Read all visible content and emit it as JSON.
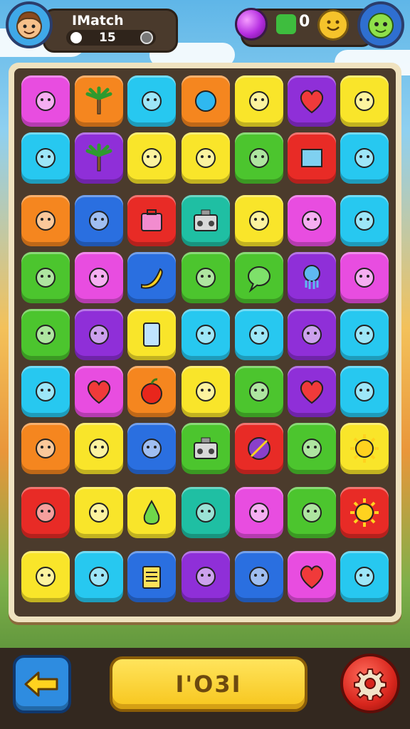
{
  "header": {
    "player_name": "IMatch",
    "score": "15",
    "puzzle_count": "0"
  },
  "footer": {
    "main_button_label": "I'O3I"
  },
  "colors": {
    "pink": "#e84de0",
    "orange": "#f5861f",
    "cyan": "#27c8f0",
    "yellow": "#f9e52a",
    "purple": "#8f2fd8",
    "red": "#e82b26",
    "green": "#4cc52e",
    "blue": "#2a6fe0",
    "teal": "#1fbfa3"
  },
  "board": {
    "rows": [
      [
        {
          "c": "pink",
          "icon": "face-icon"
        },
        {
          "c": "orange",
          "icon": "palm-tree-icon"
        },
        {
          "c": "cyan",
          "icon": "shell-icon"
        },
        {
          "c": "orange",
          "icon": "bubble-icon"
        },
        {
          "c": "yellow",
          "icon": "sprout-icon"
        },
        {
          "c": "purple",
          "icon": "heart-icon"
        },
        {
          "c": "yellow",
          "icon": "monster-icon"
        }
      ],
      [
        {
          "c": "cyan",
          "icon": "jar-icon"
        },
        {
          "c": "purple",
          "icon": "palm-tree-icon"
        },
        {
          "c": "yellow",
          "icon": "leaf-bundle-icon"
        },
        {
          "c": "yellow",
          "icon": "parachute-icon"
        },
        {
          "c": "green",
          "icon": "carrot-icon"
        },
        {
          "c": "red",
          "icon": "window-icon"
        },
        {
          "c": "cyan",
          "icon": "pig-icon"
        }
      ],
      [
        {
          "c": "orange",
          "icon": "splat-icon"
        },
        {
          "c": "blue",
          "icon": "bean-icon"
        },
        {
          "c": "red",
          "icon": "box-icon"
        },
        {
          "c": "teal",
          "icon": "radio-icon"
        },
        {
          "c": "yellow",
          "icon": "pencil-icon"
        },
        {
          "c": "pink",
          "icon": "lamp-icon"
        },
        {
          "c": "cyan",
          "icon": "lion-icon"
        }
      ],
      [
        {
          "c": "green",
          "icon": "robot-icon"
        },
        {
          "c": "pink",
          "icon": "picture-icon"
        },
        {
          "c": "blue",
          "icon": "banana-icon"
        },
        {
          "c": "green",
          "icon": "fox-icon"
        },
        {
          "c": "green",
          "icon": "speech-icon"
        },
        {
          "c": "purple",
          "icon": "octopus-icon"
        },
        {
          "c": "pink",
          "icon": "wave-icon"
        }
      ],
      [
        {
          "c": "green",
          "icon": "kite-icon"
        },
        {
          "c": "purple",
          "icon": "squiggle-icon"
        },
        {
          "c": "yellow",
          "icon": "tablet-icon"
        },
        {
          "c": "cyan",
          "icon": "dolphin-icon"
        },
        {
          "c": "cyan",
          "icon": "fish-icon"
        },
        {
          "c": "purple",
          "icon": "note-icon"
        },
        {
          "c": "cyan",
          "icon": "shoe-icon"
        }
      ],
      [
        {
          "c": "cyan",
          "icon": "brush-icon"
        },
        {
          "c": "pink",
          "icon": "heart-icon"
        },
        {
          "c": "orange",
          "icon": "apple-icon"
        },
        {
          "c": "yellow",
          "icon": "mango-icon"
        },
        {
          "c": "green",
          "icon": "wand-icon"
        },
        {
          "c": "purple",
          "icon": "heart-icon"
        },
        {
          "c": "cyan",
          "icon": "cat-icon"
        }
      ],
      [
        {
          "c": "orange",
          "icon": "star-shard-icon"
        },
        {
          "c": "yellow",
          "icon": "explorer-icon"
        },
        {
          "c": "blue",
          "icon": "squid-icon"
        },
        {
          "c": "green",
          "icon": "radio-icon"
        },
        {
          "c": "red",
          "icon": "ball-icon"
        },
        {
          "c": "green",
          "icon": "cone-icon"
        },
        {
          "c": "yellow",
          "icon": "sun-face-icon"
        }
      ],
      [
        {
          "c": "red",
          "icon": "feather-icon"
        },
        {
          "c": "yellow",
          "icon": "brush-icon"
        },
        {
          "c": "yellow",
          "icon": "pear-icon"
        },
        {
          "c": "teal",
          "icon": "robot-icon"
        },
        {
          "c": "pink",
          "icon": "bandage-icon"
        },
        {
          "c": "green",
          "icon": "bag-icon"
        },
        {
          "c": "red",
          "icon": "sun-face-icon"
        }
      ],
      [
        {
          "c": "yellow",
          "icon": "scroll-icon"
        },
        {
          "c": "cyan",
          "icon": "hat-icon"
        },
        {
          "c": "blue",
          "icon": "notepad-icon"
        },
        {
          "c": "purple",
          "icon": "marker-icon"
        },
        {
          "c": "blue",
          "icon": "duck-icon"
        },
        {
          "c": "pink",
          "icon": "heart-icon"
        },
        {
          "c": "cyan",
          "icon": "gear-flower-icon"
        }
      ]
    ]
  }
}
